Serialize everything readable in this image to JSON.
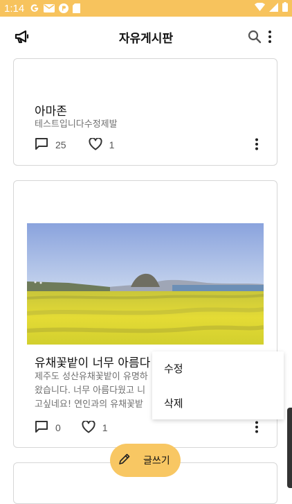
{
  "status_bar": {
    "time": "1:14",
    "icons": [
      "google-icon",
      "mail-icon",
      "pocket-icon",
      "sd-card-icon",
      "wifi-icon",
      "signal-icon",
      "battery-icon"
    ],
    "background": "#f7c35d"
  },
  "app_bar": {
    "title": "자유게시판",
    "left_icon": "megaphone-icon",
    "right_icons": [
      "search-icon",
      "more-vertical-icon"
    ]
  },
  "posts": [
    {
      "title": "아마존",
      "body": "테스트입니다수정제발",
      "comments": "25",
      "likes": "1"
    },
    {
      "title": "유채꽃밭이 너무 아름다",
      "body_lines": [
        "제주도 성산유채꽃밭이 유명하",
        "왔습니다. 너무 아름다웠고 니",
        "고싶네요! 연인과의 유채꽃밭"
      ],
      "comments": "0",
      "likes": "1",
      "image": "rapeseed-flower-field-photo"
    }
  ],
  "context_menu": {
    "items": [
      "수정",
      "삭제"
    ]
  },
  "fab": {
    "label": "글쓰기",
    "icon": "pencil-icon",
    "color": "#f8c763"
  }
}
